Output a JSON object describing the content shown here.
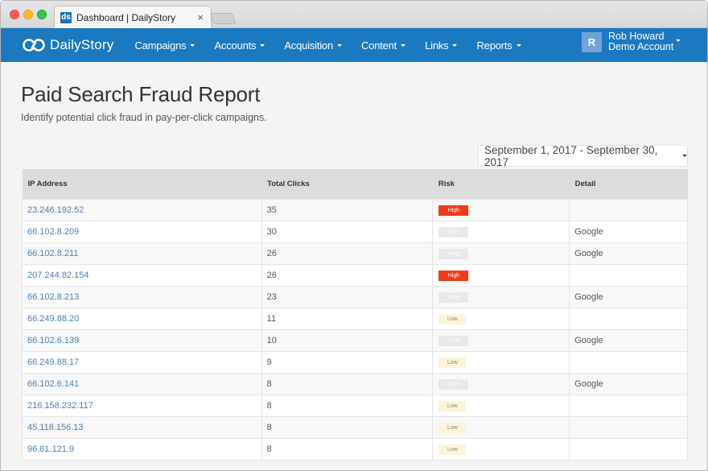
{
  "browser": {
    "tab_title": "Dashboard | DailyStory",
    "favicon_text": "ds",
    "close_glyph": "×"
  },
  "navbar": {
    "brand": "DailyStory",
    "items": [
      {
        "label": "Campaigns"
      },
      {
        "label": "Accounts"
      },
      {
        "label": "Acquisition"
      },
      {
        "label": "Content"
      },
      {
        "label": "Links"
      },
      {
        "label": "Reports"
      }
    ],
    "user": {
      "avatar_initial": "R",
      "name": "Rob Howard",
      "account": "Demo Account"
    }
  },
  "page": {
    "title": "Paid Search Fraud Report",
    "subtitle": "Identify potential click fraud in pay-per-click campaigns.",
    "date_range": "September 1, 2017 - September 30, 2017"
  },
  "table": {
    "headers": [
      "IP Address",
      "Total Clicks",
      "Risk",
      "Detail"
    ],
    "rows": [
      {
        "ip": "23.246.192.52",
        "clicks": "35",
        "risk": "High",
        "detail": ""
      },
      {
        "ip": "66.102.8.209",
        "clicks": "30",
        "risk": "None",
        "detail": "Google"
      },
      {
        "ip": "66.102.8.211",
        "clicks": "26",
        "risk": "None",
        "detail": "Google"
      },
      {
        "ip": "207.244.82.154",
        "clicks": "26",
        "risk": "High",
        "detail": ""
      },
      {
        "ip": "66.102.8.213",
        "clicks": "23",
        "risk": "None",
        "detail": "Google"
      },
      {
        "ip": "66.249.88.20",
        "clicks": "11",
        "risk": "Low",
        "detail": ""
      },
      {
        "ip": "66.102.6.139",
        "clicks": "10",
        "risk": "None",
        "detail": "Google"
      },
      {
        "ip": "66.249.88.17",
        "clicks": "9",
        "risk": "Low",
        "detail": ""
      },
      {
        "ip": "66.102.6.141",
        "clicks": "8",
        "risk": "None",
        "detail": "Google"
      },
      {
        "ip": "216.158.232.117",
        "clicks": "8",
        "risk": "Low",
        "detail": ""
      },
      {
        "ip": "45.118.156.13",
        "clicks": "8",
        "risk": "Low",
        "detail": ""
      },
      {
        "ip": "96.81.121.9",
        "clicks": "8",
        "risk": "Low",
        "detail": ""
      }
    ]
  },
  "colors": {
    "navbar": "#1a79c0",
    "risk_high": "#f23a17",
    "risk_none": "#e9e9e9",
    "risk_low": "#fbf4d7",
    "link": "#4b7fb7"
  }
}
